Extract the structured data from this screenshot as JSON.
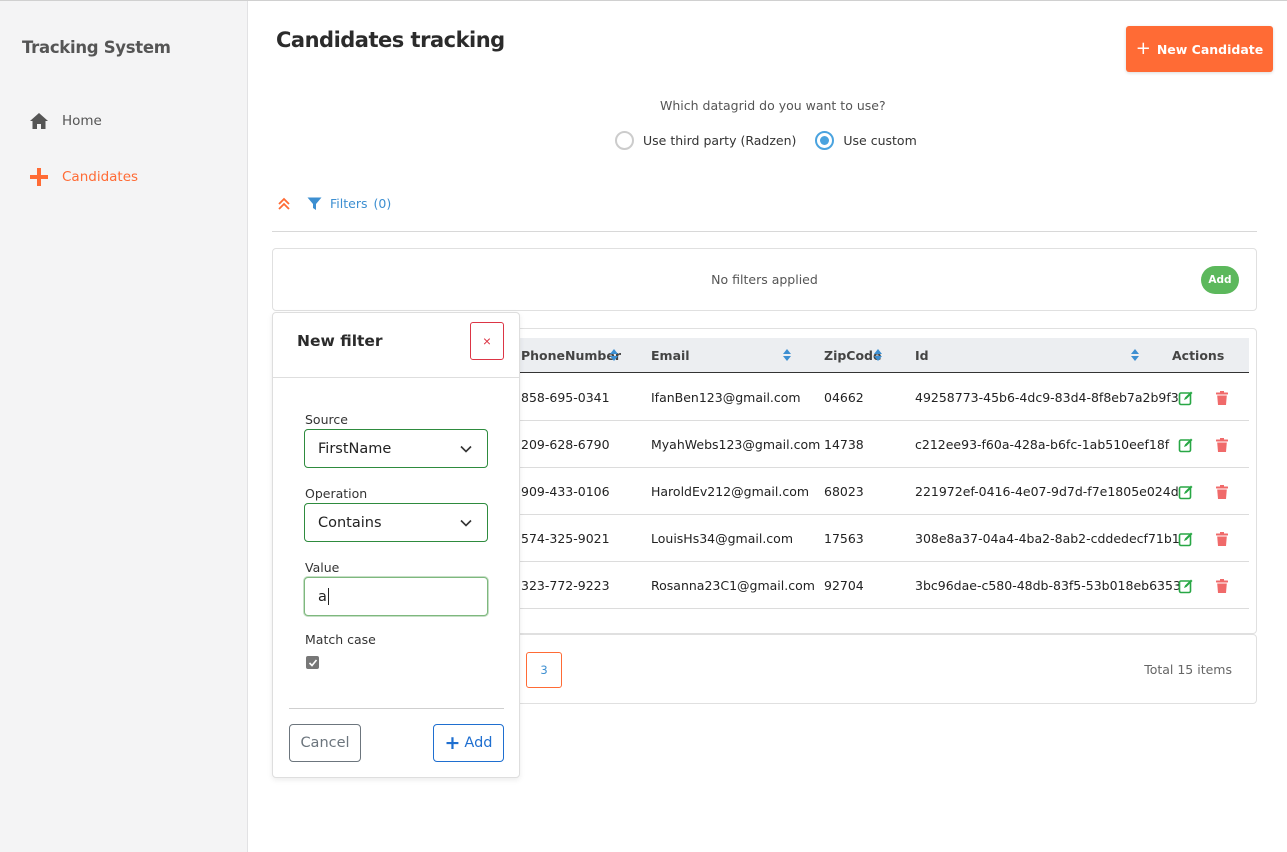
{
  "sidebar": {
    "brand": "Tracking System",
    "items": [
      {
        "label": "Home",
        "icon": "home-icon",
        "active": false
      },
      {
        "label": "Candidates",
        "icon": "plus-icon",
        "active": true
      }
    ]
  },
  "header": {
    "title": "Candidates tracking",
    "new_button_label": "New Candidate"
  },
  "datagrid_choice": {
    "question": "Which datagrid do you want to use?",
    "options": [
      {
        "label": "Use third party (Radzen)",
        "selected": false
      },
      {
        "label": "Use custom",
        "selected": true
      }
    ]
  },
  "filters": {
    "label": "Filters",
    "count": "(0)",
    "empty_text": "No filters applied",
    "add_label": "Add"
  },
  "table": {
    "columns": [
      "PhoneNumber",
      "Email",
      "ZipCode",
      "Id",
      "Actions"
    ],
    "rows": [
      {
        "phone": "858-695-0341",
        "email": "IfanBen123@gmail.com",
        "zip": "04662",
        "id": "49258773-45b6-4dc9-83d4-8f8eb7a2b9f3"
      },
      {
        "phone": "209-628-6790",
        "email": "MyahWebs123@gmail.com",
        "zip": "14738",
        "id": "c212ee93-f60a-428a-b6fc-1ab510eef18f"
      },
      {
        "phone": "909-433-0106",
        "email": "HaroldEv212@gmail.com",
        "zip": "68023",
        "id": "221972ef-0416-4e07-9d7d-f7e1805e024d"
      },
      {
        "phone": "574-325-9021",
        "email": "LouisHs34@gmail.com",
        "zip": "17563",
        "id": "308e8a37-04a4-4ba2-8ab2-cddedecf71b1"
      },
      {
        "phone": "323-772-9223",
        "email": "Rosanna23C1@gmail.com",
        "zip": "92704",
        "id": "3bc96dae-c580-48db-83f5-53b018eb6353"
      }
    ]
  },
  "pager": {
    "visible_page": "3",
    "total_text": "Total 15 items"
  },
  "new_filter_popup": {
    "title": "New filter",
    "close_symbol": "×",
    "source_label": "Source",
    "source_value": "FirstName",
    "operation_label": "Operation",
    "operation_value": "Contains",
    "value_label": "Value",
    "value": "a",
    "match_case_label": "Match case",
    "match_case_checked": true,
    "cancel_label": "Cancel",
    "add_label": "Add"
  },
  "colors": {
    "accent": "#ff6b35",
    "link": "#3d8fd1",
    "success": "#5cb85c",
    "danger": "#dc3545",
    "edit": "#28a745",
    "delete": "#f06a6a"
  }
}
